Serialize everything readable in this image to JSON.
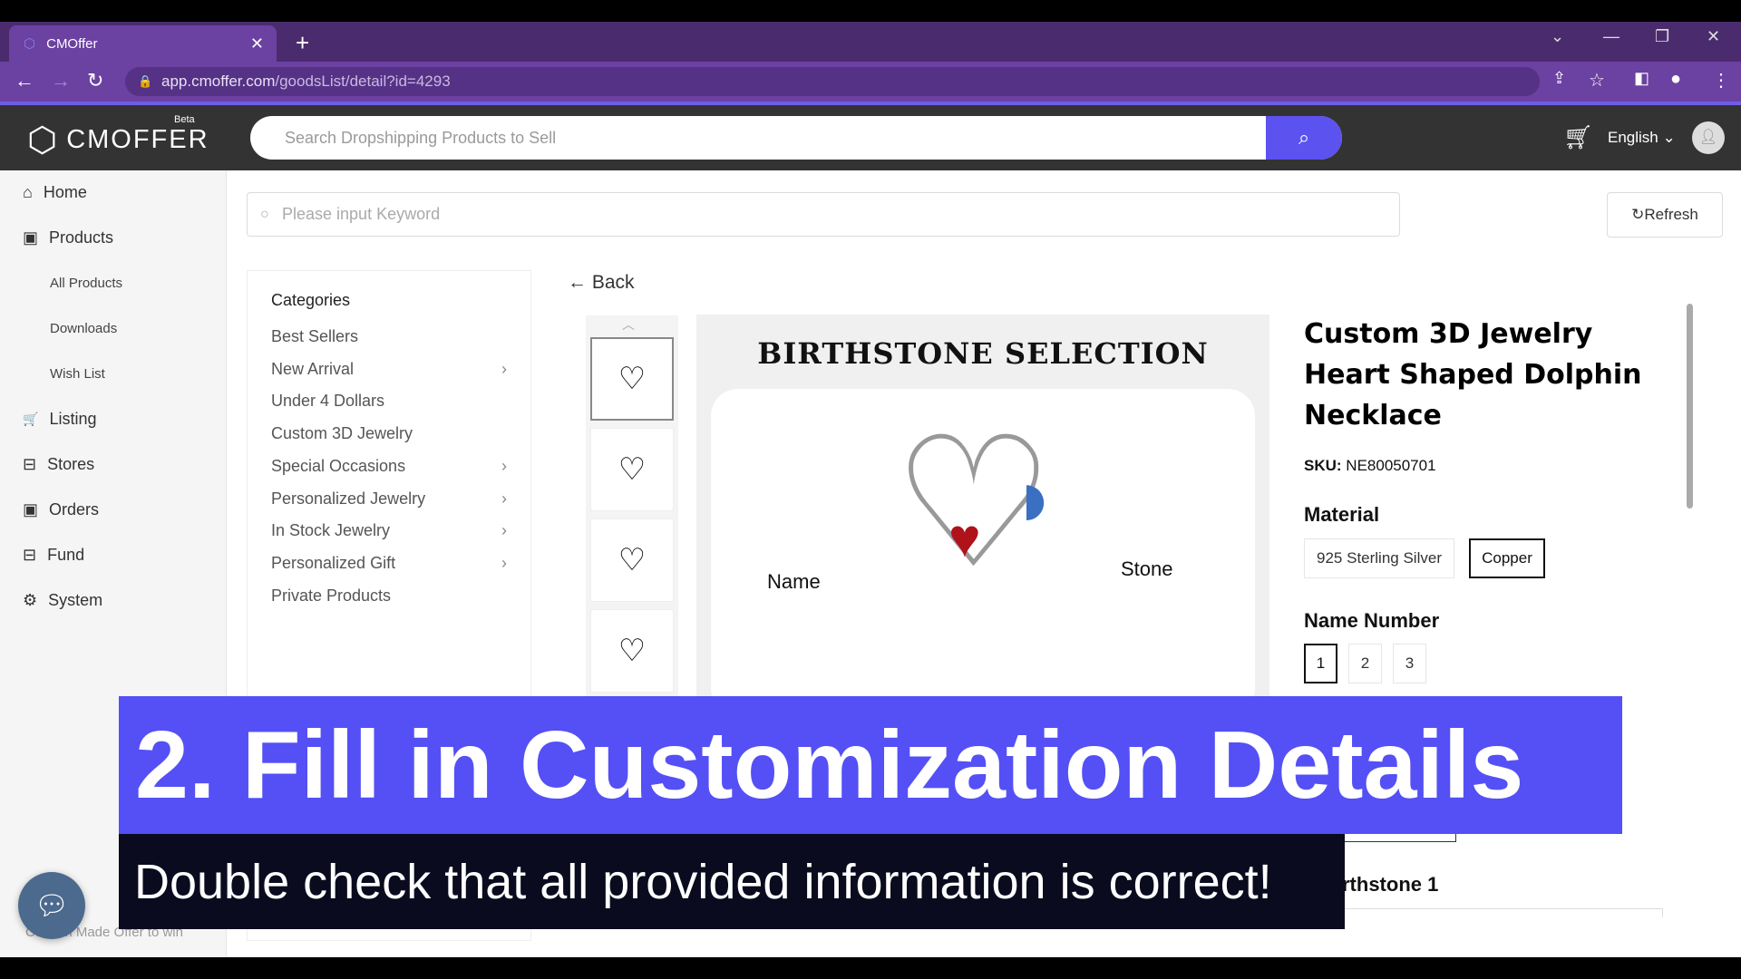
{
  "browser": {
    "tab_title": "CMOffer",
    "url_host": "app.cmoffer.com",
    "url_path": "/goodsList/detail?id=4293"
  },
  "header": {
    "logo": "CMOFFER",
    "beta": "Beta",
    "search_placeholder": "Search Dropshipping Products to Sell",
    "language": "English"
  },
  "sidebar": {
    "items": [
      {
        "label": "Home",
        "icon": "⌂"
      },
      {
        "label": "Products",
        "icon": "▣"
      },
      {
        "label": "Listing",
        "icon": "🛒"
      },
      {
        "label": "Stores",
        "icon": "⊟"
      },
      {
        "label": "Orders",
        "icon": "▣"
      },
      {
        "label": "Fund",
        "icon": "⊟"
      },
      {
        "label": "System",
        "icon": "⚙"
      }
    ],
    "sub_items": [
      "All Products",
      "Downloads",
      "Wish List"
    ],
    "footer": "Custom Made Offer to win"
  },
  "toolbar": {
    "keyword_placeholder": "Please input Keyword",
    "refresh": "Refresh"
  },
  "categories": {
    "title": "Categories",
    "items": [
      {
        "label": "Best Sellers",
        "has_children": false
      },
      {
        "label": "New Arrival",
        "has_children": true
      },
      {
        "label": "Under 4 Dollars",
        "has_children": false
      },
      {
        "label": "Custom 3D Jewelry",
        "has_children": false
      },
      {
        "label": "Special Occasions",
        "has_children": true
      },
      {
        "label": "Personalized Jewelry",
        "has_children": true
      },
      {
        "label": "In Stock Jewelry",
        "has_children": true
      },
      {
        "label": "Personalized Gift",
        "has_children": true
      },
      {
        "label": "Private Products",
        "has_children": false
      }
    ]
  },
  "product": {
    "back": "Back",
    "image_title": "BIRTHSTONE SELECTION",
    "image_label_name": "Name",
    "image_label_stone": "Stone",
    "title": "Custom 3D Jewelry Heart Shaped Dolphin Necklace",
    "sku_label": "SKU:",
    "sku": "NE80050701",
    "material_label": "Material",
    "materials": [
      "925 Sterling Silver",
      "Copper"
    ],
    "selected_material": "Copper",
    "name_number_label": "Name Number",
    "name_numbers": [
      "1",
      "2",
      "3"
    ],
    "selected_name_number": "1",
    "birthstone_label": "rthstone 1"
  },
  "overlay": {
    "headline": "2. Fill in Customization Details",
    "subtitle": "Double check that all provided information is correct!",
    "banner_color": "#5450f5"
  }
}
